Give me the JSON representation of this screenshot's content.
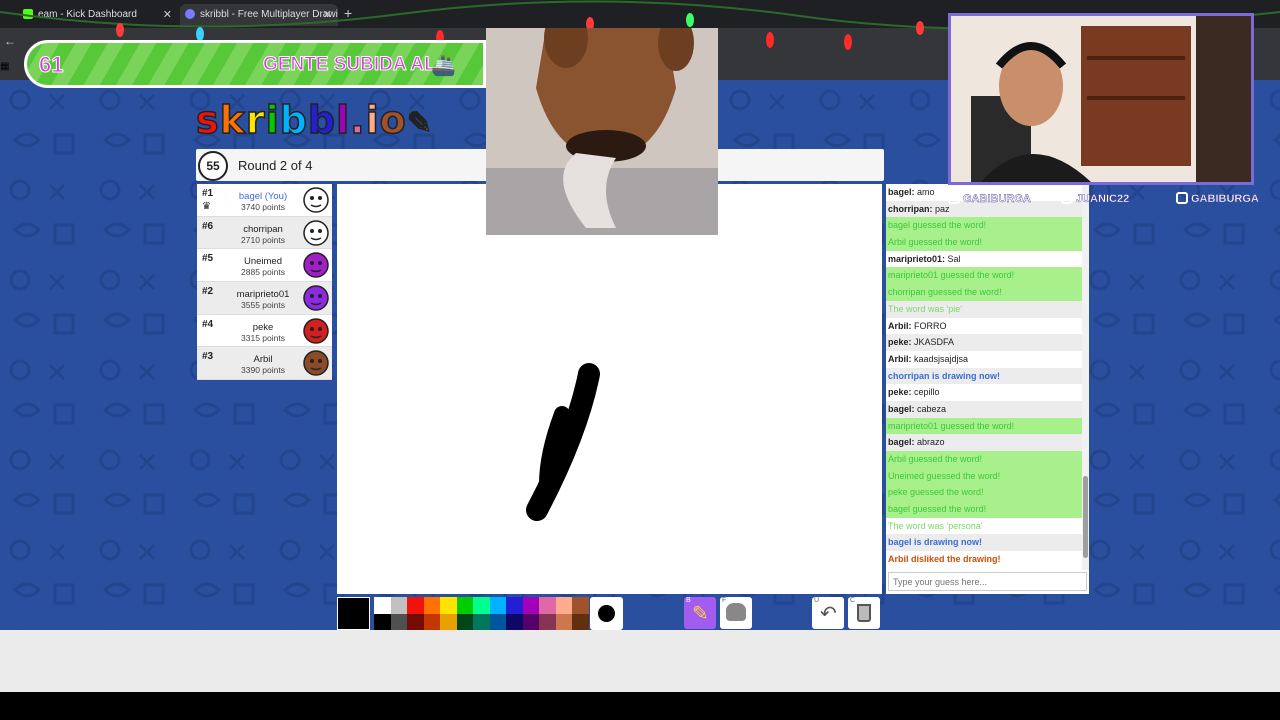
{
  "browser": {
    "tabs": [
      {
        "title": "eam - Kick Dashboard",
        "close": "✕"
      },
      {
        "title": "skribbl - Free Multiplayer Drawing",
        "close": "✕"
      }
    ],
    "new_tab": "+"
  },
  "stream_banner": {
    "count": "61",
    "text": "GENTE SUBIDA AL"
  },
  "game": {
    "logo": [
      "s",
      "k",
      "r",
      "i",
      "b",
      "b",
      "l",
      ".",
      "i",
      "o"
    ],
    "timer": "55",
    "round": "Round 2 of 4",
    "players": [
      {
        "rank": "#1",
        "name": "bagel (You)",
        "points": "3740 points",
        "you": true,
        "avatar_color": "#ffffff"
      },
      {
        "rank": "#6",
        "name": "chorripan",
        "points": "2710 points",
        "you": false,
        "avatar_color": "#ffffff"
      },
      {
        "rank": "#5",
        "name": "Uneimed",
        "points": "2885 points",
        "you": false,
        "avatar_color": "#a020c8"
      },
      {
        "rank": "#2",
        "name": "mariprieto01",
        "points": "3555 points",
        "you": false,
        "avatar_color": "#8a2be2"
      },
      {
        "rank": "#4",
        "name": "peke",
        "points": "3315 points",
        "you": false,
        "avatar_color": "#d22020"
      },
      {
        "rank": "#3",
        "name": "Arbil",
        "points": "3390 points",
        "you": false,
        "avatar_color": "#8b4a2a"
      }
    ],
    "chat": [
      {
        "type": "normal",
        "user": "bagel:",
        "text": " amo"
      },
      {
        "type": "normal",
        "user": "chorripan:",
        "text": " paz"
      },
      {
        "type": "green",
        "user": "",
        "text": "bagel guessed the word!"
      },
      {
        "type": "green",
        "user": "",
        "text": "Arbil guessed the word!"
      },
      {
        "type": "normal",
        "user": "mariprieto01:",
        "text": " Sal"
      },
      {
        "type": "green",
        "user": "",
        "text": "mariprieto01 guessed the word!"
      },
      {
        "type": "green",
        "user": "",
        "text": "chorripan guessed the word!"
      },
      {
        "type": "word",
        "user": "",
        "text": "The word was 'pie'"
      },
      {
        "type": "normal",
        "user": "Arbil:",
        "text": " FORRO"
      },
      {
        "type": "normal",
        "user": "peke:",
        "text": " JKASDFA"
      },
      {
        "type": "normal",
        "user": "Arbil:",
        "text": " kaadsjsajdjsa"
      },
      {
        "type": "blue",
        "user": "",
        "text": "chorripan is drawing now!"
      },
      {
        "type": "normal",
        "user": "peke:",
        "text": " cepillo"
      },
      {
        "type": "normal",
        "user": "bagel:",
        "text": " cabeza"
      },
      {
        "type": "green",
        "user": "",
        "text": "mariprieto01 guessed the word!"
      },
      {
        "type": "normal",
        "user": "bagel:",
        "text": " abrazo"
      },
      {
        "type": "green",
        "user": "",
        "text": "Arbil guessed the word!"
      },
      {
        "type": "green",
        "user": "",
        "text": "Uneimed guessed the word!"
      },
      {
        "type": "green",
        "user": "",
        "text": "peke guessed the word!"
      },
      {
        "type": "green",
        "user": "",
        "text": "bagel guessed the word!"
      },
      {
        "type": "word",
        "user": "",
        "text": "The word was 'persona'"
      },
      {
        "type": "blue",
        "user": "",
        "text": "bagel is drawing now!"
      },
      {
        "type": "red",
        "user": "",
        "text": "Arbil disliked the drawing!"
      }
    ],
    "guess_placeholder": "Type your guess here...",
    "palette_top": [
      "#ffffff",
      "#c1c1c1",
      "#ef130b",
      "#ff7100",
      "#ffe400",
      "#00cc00",
      "#00ff91",
      "#00b2ff",
      "#231fd3",
      "#a300ba",
      "#df69a7",
      "#ffac8e",
      "#a0522d"
    ],
    "palette_bottom": [
      "#000000",
      "#505050",
      "#740b07",
      "#c23800",
      "#e8a200",
      "#004619",
      "#00785d",
      "#00569e",
      "#0e0865",
      "#550069",
      "#873554",
      "#cc774d",
      "#63300d"
    ],
    "tools": {
      "brush_key": "B",
      "fill_key": "F",
      "undo_key": "U",
      "clear_key": "C"
    }
  },
  "socials": [
    {
      "label": "GABIBURGA",
      "icon": "twitter-icon"
    },
    {
      "label": "JUANIC22",
      "icon": "kick-icon"
    },
    {
      "label": "GABIBURGA",
      "icon": "instagram-icon"
    }
  ],
  "colors": {
    "game_bg": "#2a4f9e",
    "accent_purple": "#7c6bd6",
    "banner_text": "#d93be0"
  }
}
